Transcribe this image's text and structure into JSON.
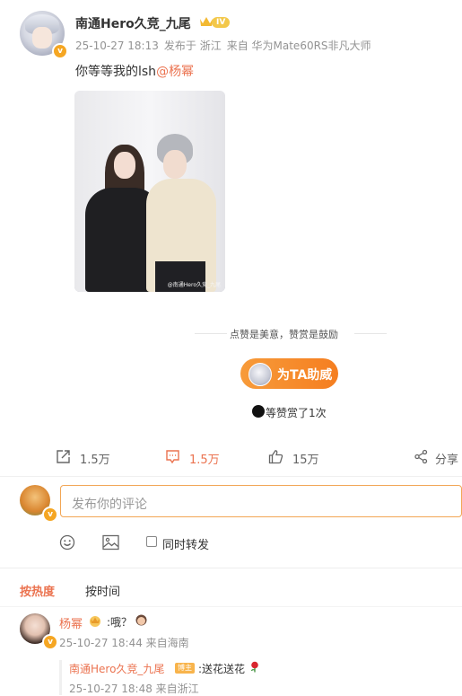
{
  "post": {
    "author": "南通Hero久竞_九尾",
    "level": "IV",
    "date": "25-10-27 18:13",
    "location": "发布于 浙江",
    "source": "来自 华为Mate60RS非凡大师",
    "text": "你等等我的lsh",
    "mention": "@杨幂",
    "photo_watermark": "@南通Hero久竞_九尾"
  },
  "reward": {
    "divider_text": "点赞是美意，赞赏是鼓励",
    "button_label": "为TA助威",
    "count_text": "等赞赏了1次"
  },
  "actions": {
    "repost": "1.5万",
    "comment": "1.5万",
    "like": "15万",
    "share": "分享"
  },
  "composer": {
    "placeholder": "发布你的评论",
    "repost_label": "同时转发"
  },
  "tabs": {
    "hot": "按热度",
    "time": "按时间"
  },
  "comments": [
    {
      "name": "杨幂",
      "text": ":哦？",
      "meta": "25-10-27 18:44 来自海南",
      "reply": {
        "name": "南通Hero久竞_九尾",
        "tag": "博主",
        "text": ":送花送花",
        "meta": "25-10-27 18:48 来自浙江"
      }
    }
  ],
  "colors": {
    "accent": "#eb7350",
    "reward": "#f57e20"
  }
}
